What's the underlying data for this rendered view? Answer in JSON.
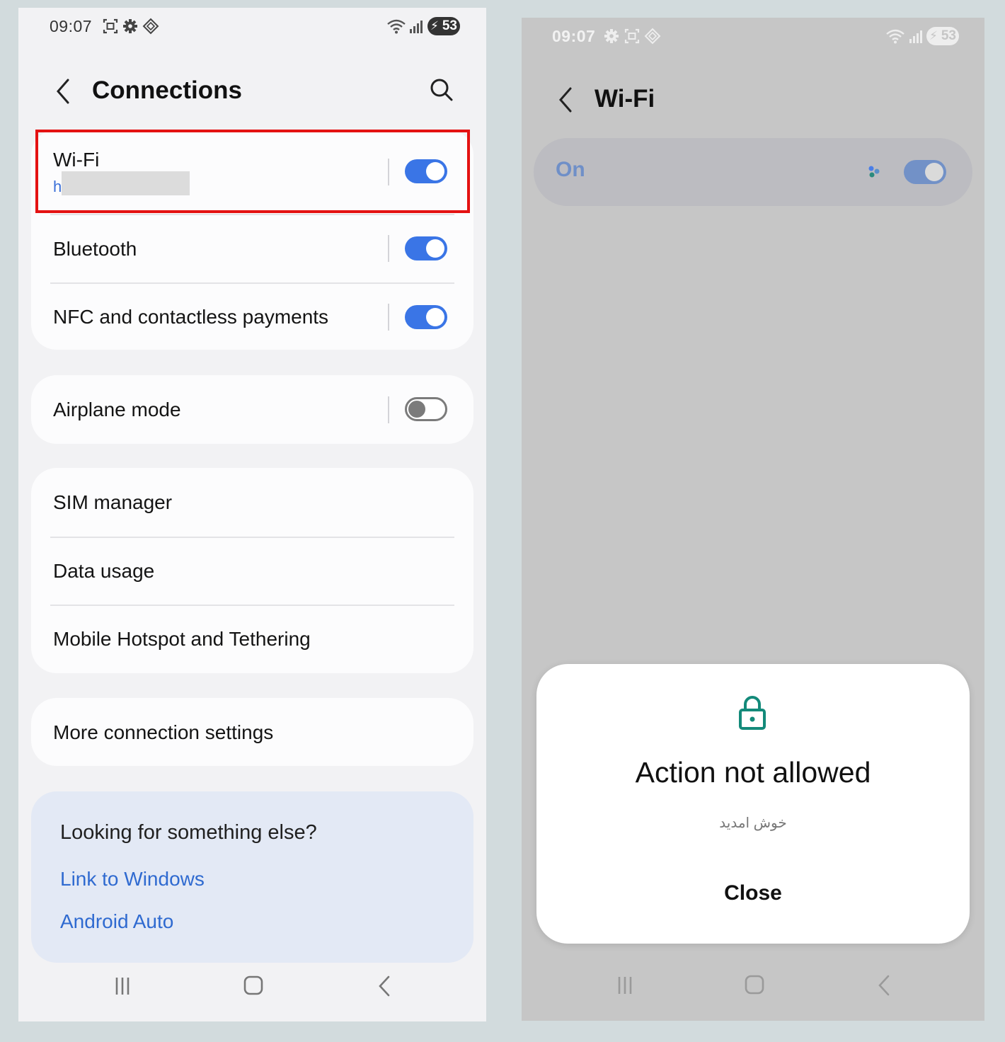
{
  "left_screen": {
    "status_time": "09:07",
    "battery_level": "53",
    "title": "Connections",
    "wifi": {
      "label": "Wi-Fi",
      "sub_text": "h",
      "state": "on"
    },
    "bluetooth": {
      "label": "Bluetooth",
      "state": "on"
    },
    "nfc": {
      "label": "NFC and contactless payments",
      "state": "on"
    },
    "airplane": {
      "label": "Airplane mode",
      "state": "off"
    },
    "sim_manager": "SIM manager",
    "data_usage": "Data usage",
    "hotspot": "Mobile Hotspot and Tethering",
    "more_settings": "More connection settings",
    "suggestions": {
      "title": "Looking for something else?",
      "links": [
        "Link to Windows",
        "Android Auto"
      ]
    },
    "colors": {
      "accent": "#3a75e6",
      "link": "#2f6ad0",
      "highlight": "#e41212"
    }
  },
  "right_screen": {
    "status_time": "09:07",
    "battery_level": "53",
    "title": "Wi-Fi",
    "master_switch_label": "On",
    "dialog": {
      "icon": "lock-icon",
      "title": "Action not allowed",
      "message": "خوش امدید",
      "close_label": "Close",
      "icon_color": "#138a7a"
    }
  }
}
